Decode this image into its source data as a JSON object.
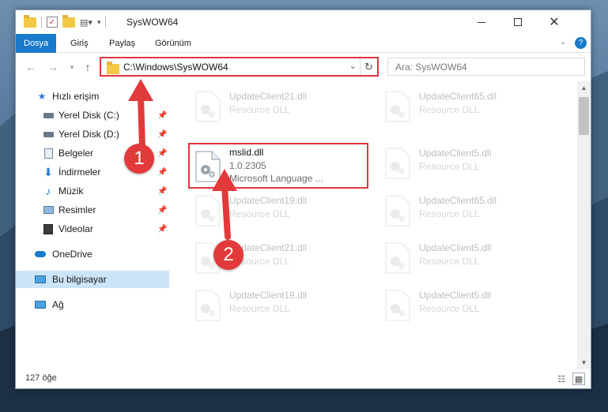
{
  "window": {
    "title": "SysWOW64"
  },
  "ribbon": {
    "tabs": [
      {
        "label": "Dosya",
        "active": true
      },
      {
        "label": "Giriş"
      },
      {
        "label": "Paylaş"
      },
      {
        "label": "Görünüm"
      }
    ]
  },
  "address": {
    "path": "C:\\Windows\\SysWOW64",
    "search_placeholder": "Ara: SysWOW64"
  },
  "sidebar": {
    "items": [
      {
        "label": "Hızlı erişim",
        "icon": "star-icon"
      },
      {
        "label": "Yerel Disk (C:)",
        "icon": "drive-icon"
      },
      {
        "label": "Yerel Disk (D:)",
        "icon": "drive-icon"
      },
      {
        "label": "Belgeler",
        "icon": "documents-icon"
      },
      {
        "label": "İndirmeler",
        "icon": "download-icon"
      },
      {
        "label": "Müzik",
        "icon": "music-icon"
      },
      {
        "label": "Resimler",
        "icon": "pictures-icon"
      },
      {
        "label": "Videolar",
        "icon": "videos-icon"
      },
      {
        "label": "OneDrive",
        "icon": "cloud-icon"
      },
      {
        "label": "Bu bilgisayar",
        "icon": "computer-icon",
        "selected": true
      },
      {
        "label": "Ağ",
        "icon": "network-icon"
      }
    ]
  },
  "files": {
    "left": [
      {
        "name": "UpdateClient21.dll",
        "type": "Resource DLL"
      },
      {
        "name": "mslid.dll",
        "version": "1.0.2305",
        "desc": "Microsoft Language ..."
      },
      {
        "name": "UpdateClient19.dll",
        "type": "Resource DLL"
      },
      {
        "name": "UpdateClient21.dll",
        "type": "Resource DLL"
      },
      {
        "name": "UpdateClient19.dll",
        "type": "Resource DLL"
      }
    ],
    "right": [
      {
        "name": "UpdateClient65.dll",
        "type": "Resource DLL"
      },
      {
        "name": "UpdateClient5.dll",
        "type": "Resource DLL"
      },
      {
        "name": "UpdateClient65.dll",
        "type": "Resource DLL"
      },
      {
        "name": "UpdateClient5.dll",
        "type": "Resource DLL"
      },
      {
        "name": "UpdateClient5.dll",
        "type": "Resource DLL"
      }
    ]
  },
  "status": {
    "count": "127 öğe"
  },
  "annotations": {
    "step1": "1",
    "step2": "2",
    "color": "#e23a3a"
  },
  "colors": {
    "accent": "#1979ca",
    "highlight": "#e0353f",
    "selected": "#cce4f7"
  }
}
